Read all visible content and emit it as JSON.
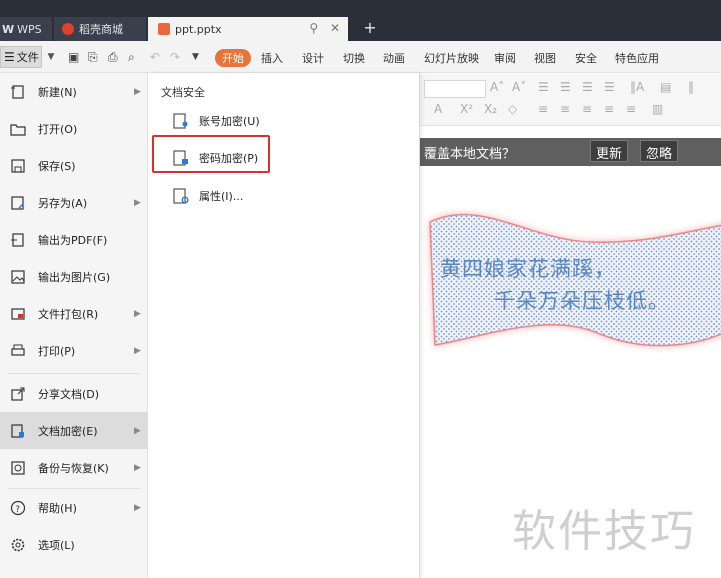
{
  "tabs": [
    {
      "label": "WPS"
    },
    {
      "label": "稻壳商城"
    },
    {
      "label": "ppt.pptx"
    }
  ],
  "new_tab_label": "+",
  "ribbon": {
    "file_label": "文件",
    "tabs": [
      "开始",
      "插入",
      "设计",
      "切换",
      "动画",
      "幻灯片放映",
      "审阅",
      "视图",
      "安全",
      "特色应用"
    ]
  },
  "file_menu": {
    "items": [
      {
        "label": "新建(N)",
        "icon": "new-icon",
        "has_arrow": true
      },
      {
        "label": "打开(O)",
        "icon": "folder-open-icon",
        "has_arrow": false
      },
      {
        "label": "保存(S)",
        "icon": "save-icon",
        "has_arrow": false
      },
      {
        "label": "另存为(A)",
        "icon": "save-as-icon",
        "has_arrow": true
      },
      {
        "label": "输出为PDF(F)",
        "icon": "pdf-icon",
        "has_arrow": false
      },
      {
        "label": "输出为图片(G)",
        "icon": "image-icon",
        "has_arrow": false
      },
      {
        "label": "文件打包(R)",
        "icon": "package-icon",
        "has_arrow": true
      },
      {
        "label": "打印(P)",
        "icon": "print-icon",
        "has_arrow": true
      },
      {
        "label": "分享文档(D)",
        "icon": "share-icon",
        "has_arrow": false
      },
      {
        "label": "文档加密(E)",
        "icon": "lock-document-icon",
        "has_arrow": true,
        "active": true
      },
      {
        "label": "备份与恢复(K)",
        "icon": "backup-icon",
        "has_arrow": true
      },
      {
        "label": "帮助(H)",
        "icon": "help-icon",
        "has_arrow": true
      },
      {
        "label": "选项(L)",
        "icon": "gear-icon",
        "has_arrow": false
      }
    ]
  },
  "submenu": {
    "title": "文档安全",
    "items": [
      {
        "label": "账号加密(U)",
        "icon": "account-lock-icon"
      },
      {
        "label": "密码加密(P)",
        "icon": "password-lock-icon",
        "highlighted": true
      },
      {
        "label": "属性(I)...",
        "icon": "properties-icon"
      }
    ]
  },
  "notification": {
    "text": "覆盖本地文档？",
    "update_label": "更新",
    "ignore_label": "忽略"
  },
  "slide": {
    "line1": "黄四娘家花满蹊，",
    "line2": "千朵万朵压枝低。"
  },
  "watermark": "软件技巧",
  "colors": {
    "accent": "#e8743b",
    "highlight_border": "#d9302c",
    "poem_text": "#5a86c0"
  }
}
